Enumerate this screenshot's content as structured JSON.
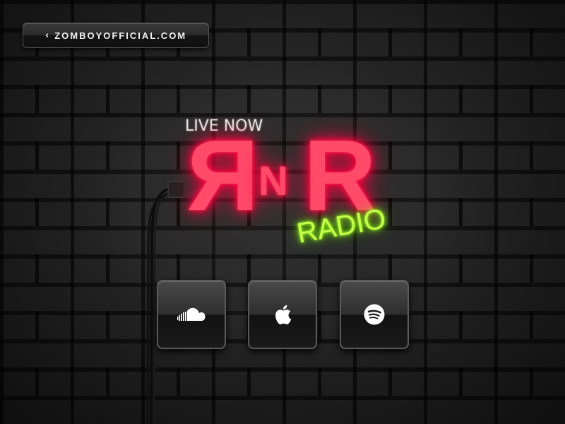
{
  "nav": {
    "back_link_label": "ZOMBOYOFFICIAL.COM",
    "back_icon": "chevron-left-icon"
  },
  "hero": {
    "status_text": "LIVE NOW",
    "logo": {
      "left_letter": "R",
      "middle_letter": "N",
      "right_letter": "R",
      "sub_word": "RADIO"
    }
  },
  "services": [
    {
      "name": "SoundCloud",
      "icon": "soundcloud-icon"
    },
    {
      "name": "Apple Music",
      "icon": "apple-icon"
    },
    {
      "name": "Spotify",
      "icon": "spotify-icon"
    }
  ],
  "colors": {
    "neon_pink": "#ff2a55",
    "neon_green": "#9dff2a",
    "brick_dark": "#1b1b1b"
  }
}
